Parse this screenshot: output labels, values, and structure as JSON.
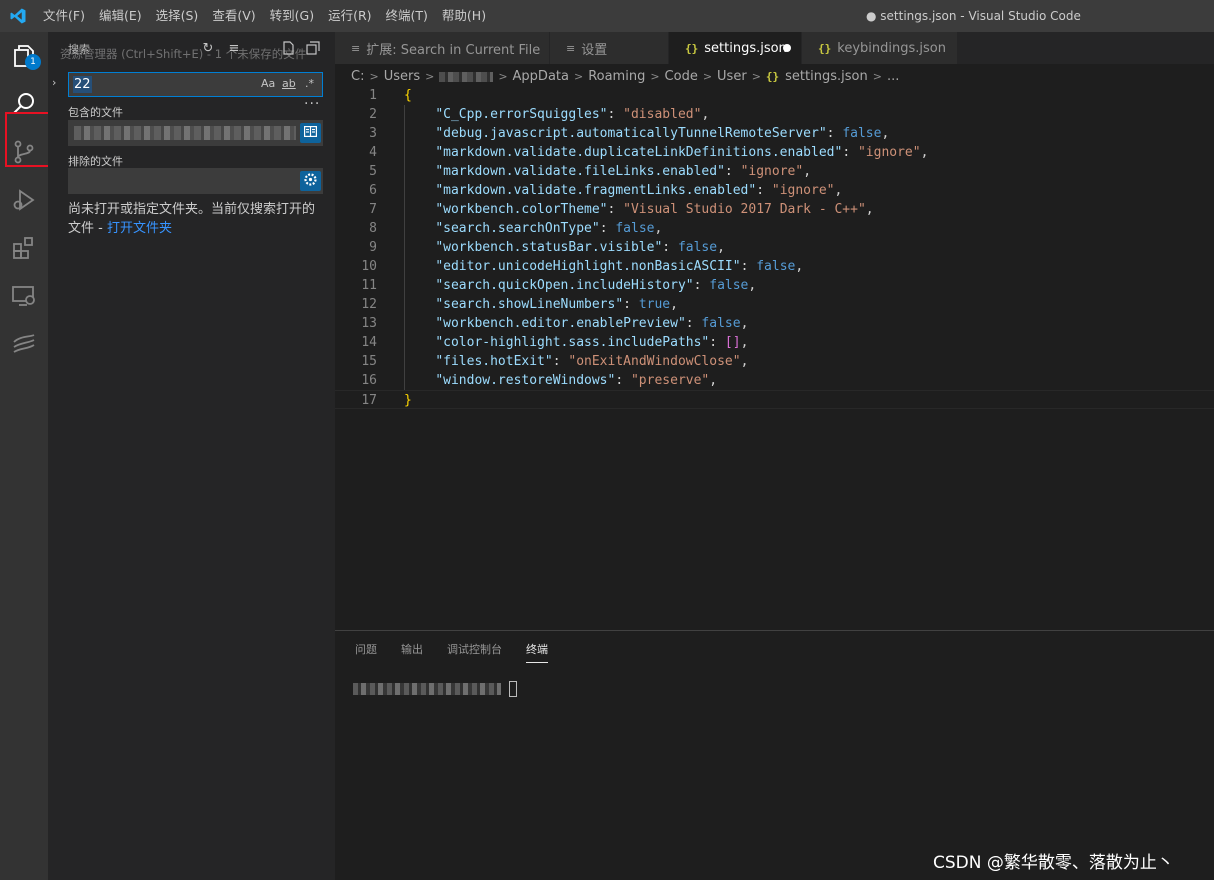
{
  "titlebar": {
    "menu": [
      "文件(F)",
      "编辑(E)",
      "选择(S)",
      "查看(V)",
      "转到(G)",
      "运行(R)",
      "终端(T)",
      "帮助(H)"
    ],
    "window_title": "● settings.json - Visual Studio Code"
  },
  "activitybar": {
    "explorer_badge": "1",
    "items": [
      "files-icon",
      "search-icon",
      "source-control-icon",
      "run-debug-icon",
      "extensions-icon",
      "remote-explorer-icon",
      "extension-icon"
    ]
  },
  "sidebar": {
    "title": "搜索",
    "hint": "资源管理器 (Ctrl+Shift+E) - 1 个未保存的文件",
    "search_value": "22",
    "options": {
      "case": "Aa",
      "word": "ab",
      "regex": ".*"
    },
    "include_label": "包含的文件",
    "exclude_label": "排除的文件",
    "message_prefix": "尚未打开或指定文件夹。当前仅搜索打开的文件 - ",
    "message_link": "打开文件夹"
  },
  "tabs": [
    {
      "label": "扩展: Search in Current File",
      "icon": "preview-icon"
    },
    {
      "label": "设置",
      "icon": "settings-icon"
    },
    {
      "label": "settings.json",
      "icon": "json-icon",
      "dirty": true
    },
    {
      "label": "keybindings.json",
      "icon": "json-icon"
    }
  ],
  "breadcrumb": {
    "parts": [
      "C:",
      "Users",
      "AppData",
      "Roaming",
      "Code",
      "User",
      "settings.json",
      "..."
    ]
  },
  "editor": {
    "lines": [
      {
        "n": "1",
        "text": "{"
      },
      {
        "n": "2",
        "text": "    \"C_Cpp.errorSquiggles\": \"disabled\","
      },
      {
        "n": "3",
        "text": "    \"debug.javascript.automaticallyTunnelRemoteServer\": false,"
      },
      {
        "n": "4",
        "text": "    \"markdown.validate.duplicateLinkDefinitions.enabled\": \"ignore\","
      },
      {
        "n": "5",
        "text": "    \"markdown.validate.fileLinks.enabled\": \"ignore\","
      },
      {
        "n": "6",
        "text": "    \"markdown.validate.fragmentLinks.enabled\": \"ignore\","
      },
      {
        "n": "7",
        "text": "    \"workbench.colorTheme\": \"Visual Studio 2017 Dark - C++\","
      },
      {
        "n": "8",
        "text": "    \"search.searchOnType\": false,"
      },
      {
        "n": "9",
        "text": "    \"workbench.statusBar.visible\": false,"
      },
      {
        "n": "10",
        "text": "    \"editor.unicodeHighlight.nonBasicASCII\": false,"
      },
      {
        "n": "11",
        "text": "    \"search.quickOpen.includeHistory\": false,"
      },
      {
        "n": "12",
        "text": "    \"search.showLineNumbers\": true,"
      },
      {
        "n": "13",
        "text": "    \"workbench.editor.enablePreview\": false,"
      },
      {
        "n": "14",
        "text": "    \"color-highlight.sass.includePaths\": [],"
      },
      {
        "n": "15",
        "text": "    \"files.hotExit\": \"onExitAndWindowClose\","
      },
      {
        "n": "16",
        "text": "    \"window.restoreWindows\": \"preserve\","
      },
      {
        "n": "17",
        "text": "}"
      }
    ]
  },
  "panel": {
    "tabs": [
      "问题",
      "输出",
      "调试控制台",
      "终端"
    ],
    "active_tab": "终端"
  },
  "watermark": "CSDN @繁华散零、落散为止丶",
  "colors": {
    "accent": "#007acc",
    "highlight_border": "#e81123",
    "link": "#3794ff"
  }
}
